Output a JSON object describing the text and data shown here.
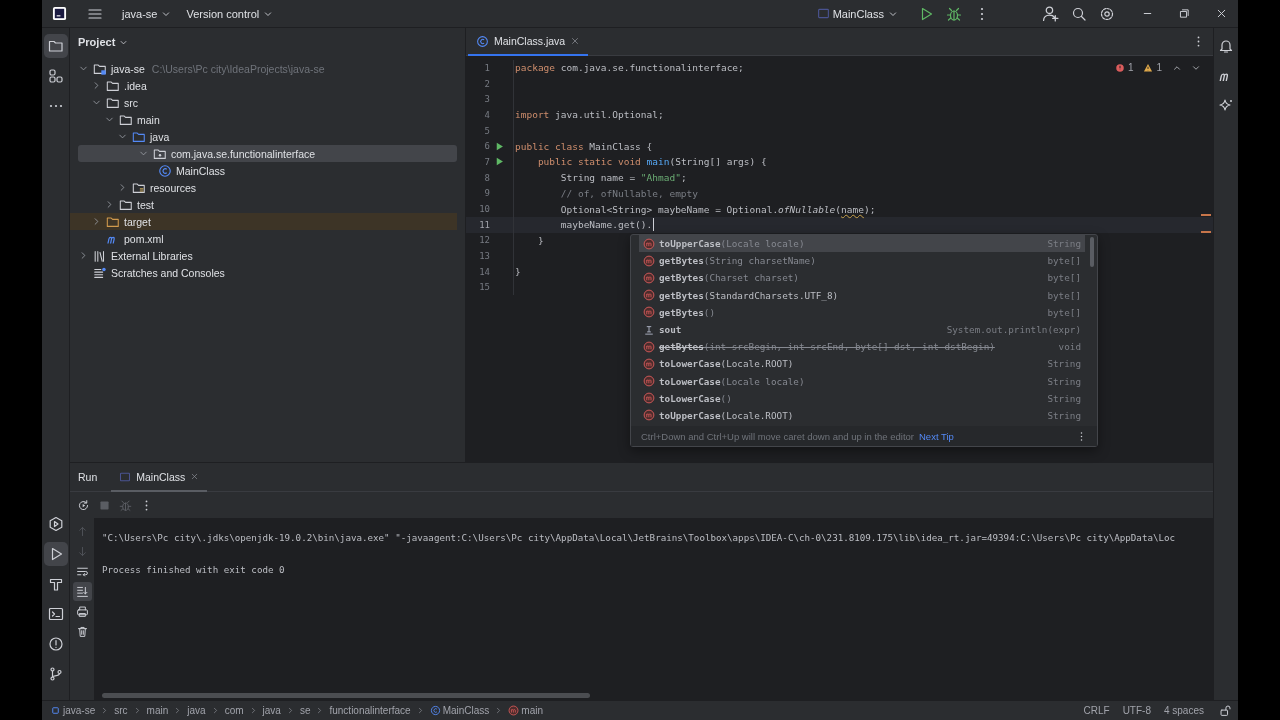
{
  "toolbar": {
    "project": "java-se",
    "vcs": "Version control",
    "run_config": "MainClass"
  },
  "project_panel": {
    "title": "Project",
    "tree": [
      {
        "label": "java-se",
        "hint": "C:\\Users\\Pc city\\IdeaProjects\\java-se",
        "kind": "module",
        "expanded": true,
        "selected": false,
        "children": [
          {
            "label": ".idea",
            "kind": "folder",
            "expanded": false,
            "selected": false
          },
          {
            "label": "src",
            "kind": "folder",
            "expanded": true,
            "selected": false,
            "children": [
              {
                "label": "main",
                "kind": "folder",
                "expanded": true,
                "selected": false,
                "children": [
                  {
                    "label": "java",
                    "kind": "source",
                    "expanded": true,
                    "selected": false,
                    "children": [
                      {
                        "label": "com.java.se.functionalinterface",
                        "kind": "package",
                        "expanded": true,
                        "selected": true,
                        "children": [
                          {
                            "label": "MainClass",
                            "kind": "class",
                            "selected": false
                          }
                        ]
                      }
                    ]
                  },
                  {
                    "label": "resources",
                    "kind": "resources",
                    "expanded": false,
                    "selected": false
                  }
                ]
              },
              {
                "label": "test",
                "kind": "folder",
                "expanded": false,
                "selected": false
              }
            ]
          },
          {
            "label": "target",
            "kind": "excluded",
            "expanded": false,
            "selected": false
          },
          {
            "label": "pom.xml",
            "kind": "maven",
            "selected": false
          }
        ]
      },
      {
        "label": "External Libraries",
        "kind": "libraries",
        "expanded": false,
        "selected": false
      },
      {
        "label": "Scratches and Consoles",
        "kind": "scratches",
        "selected": false
      }
    ]
  },
  "editor": {
    "tabs": [
      {
        "label": "MainClass.java",
        "selected": true
      }
    ],
    "errors": "1",
    "warnings": "1",
    "lines": [
      {
        "number": "1",
        "run_marker": false,
        "current": false,
        "tokens": [
          {
            "kind": "kw",
            "text": "package "
          },
          {
            "kind": "plain",
            "text": "com.java.se.functionalinterface;"
          }
        ]
      },
      {
        "number": "2",
        "run_marker": false,
        "current": false
      },
      {
        "number": "3",
        "run_marker": false,
        "current": false
      },
      {
        "number": "4",
        "run_marker": false,
        "current": false,
        "tokens": [
          {
            "kind": "kw",
            "text": "import "
          },
          {
            "kind": "plain",
            "text": "java.util.Optional;"
          }
        ]
      },
      {
        "number": "5",
        "run_marker": false,
        "current": false
      },
      {
        "number": "6",
        "run_marker": true,
        "current": false,
        "tokens": [
          {
            "kind": "kw",
            "text": "public class "
          },
          {
            "kind": "plain",
            "text": "MainClass {"
          }
        ]
      },
      {
        "number": "7",
        "run_marker": true,
        "current": false,
        "tokens": [
          {
            "kind": "kw",
            "text": "    public static void "
          },
          {
            "kind": "fn",
            "text": "main"
          },
          {
            "kind": "plain",
            "text": "(String[] args) {"
          }
        ]
      },
      {
        "number": "8",
        "run_marker": false,
        "current": false,
        "tokens": [
          {
            "kind": "plain",
            "text": "        String name = "
          },
          {
            "kind": "str",
            "text": "\"Ahmad\""
          },
          {
            "kind": "plain",
            "text": ";"
          }
        ]
      },
      {
        "number": "9",
        "run_marker": false,
        "current": false,
        "tokens": [
          {
            "kind": "cmt",
            "text": "        // of, ofNullable, empty"
          }
        ]
      },
      {
        "number": "10",
        "run_marker": false,
        "current": false,
        "tokens": [
          {
            "kind": "plain",
            "text": "        Optional<String> maybeName = Optional."
          },
          {
            "kind": "it",
            "text": "ofNullable"
          },
          {
            "kind": "plain",
            "text": "("
          },
          {
            "kind": "warn",
            "text": "name"
          },
          {
            "kind": "plain",
            "text": ");"
          }
        ]
      },
      {
        "number": "11",
        "run_marker": false,
        "current": true,
        "tokens": [
          {
            "kind": "plain",
            "text": "        maybeName.get()."
          }
        ]
      },
      {
        "number": "12",
        "run_marker": false,
        "current": false,
        "tokens": [
          {
            "kind": "plain",
            "text": "    }"
          }
        ]
      },
      {
        "number": "13",
        "run_marker": false,
        "current": false
      },
      {
        "number": "14",
        "run_marker": false,
        "current": false,
        "tokens": [
          {
            "kind": "plain",
            "text": "}"
          }
        ]
      },
      {
        "number": "15",
        "run_marker": false,
        "current": false
      }
    ]
  },
  "completion": {
    "items": [
      {
        "kind": "method",
        "name": "toUpperCase",
        "tail": "(Locale locale)",
        "tail_dim": true,
        "type": "String",
        "deprecated": false,
        "selected": true
      },
      {
        "kind": "method",
        "name": "getBytes",
        "tail": "(String charsetName)",
        "tail_dim": true,
        "type": "byte[]",
        "deprecated": false,
        "selected": false
      },
      {
        "kind": "method",
        "name": "getBytes",
        "tail": "(Charset charset)",
        "tail_dim": true,
        "type": "byte[]",
        "deprecated": false,
        "selected": false
      },
      {
        "kind": "method",
        "name": "getBytes",
        "tail": "(StandardCharsets.UTF_8)",
        "tail_dim": false,
        "type": "byte[]",
        "deprecated": false,
        "selected": false
      },
      {
        "kind": "method",
        "name": "getBytes",
        "tail": "()",
        "tail_dim": true,
        "type": "byte[]",
        "deprecated": false,
        "selected": false
      },
      {
        "kind": "template",
        "name": "sout",
        "type": "System.out.println(expr)",
        "deprecated": false,
        "selected": false
      },
      {
        "kind": "method",
        "name": "getBytes",
        "tail": "(int srcBegin, int srcEnd, byte[] dst, int dstBegin)",
        "tail_dim": true,
        "type": "void",
        "deprecated": true,
        "selected": false
      },
      {
        "kind": "method",
        "name": "toLowerCase",
        "tail": "(Locale.ROOT)",
        "tail_dim": false,
        "type": "String",
        "deprecated": false,
        "selected": false
      },
      {
        "kind": "method",
        "name": "toLowerCase",
        "tail": "(Locale locale)",
        "tail_dim": true,
        "type": "String",
        "deprecated": false,
        "selected": false
      },
      {
        "kind": "method",
        "name": "toLowerCase",
        "tail": "()",
        "tail_dim": true,
        "type": "String",
        "deprecated": false,
        "selected": false
      },
      {
        "kind": "method",
        "name": "toUpperCase",
        "tail": "(Locale.ROOT)",
        "tail_dim": false,
        "type": "String",
        "deprecated": false,
        "selected": false
      }
    ],
    "tip": "Ctrl+Down and Ctrl+Up will move caret down and up in the editor",
    "tip_link": "Next Tip"
  },
  "run_panel": {
    "title": "Run",
    "tabs": [
      {
        "label": "MainClass",
        "selected": true
      }
    ],
    "console": [
      "\"C:\\Users\\Pc city\\.jdks\\openjdk-19.0.2\\bin\\java.exe\" \"-javaagent:C:\\Users\\Pc city\\AppData\\Local\\JetBrains\\Toolbox\\apps\\IDEA-C\\ch-0\\231.8109.175\\lib\\idea_rt.jar=49394:C:\\Users\\Pc city\\AppData\\Loc",
      "Process finished with exit code 0"
    ]
  },
  "status_bar": {
    "breadcrumbs": [
      {
        "label": "java-se",
        "kind": "module"
      },
      {
        "label": "src",
        "kind": "folder"
      },
      {
        "label": "main",
        "kind": "folder"
      },
      {
        "label": "java",
        "kind": "folder"
      },
      {
        "label": "com",
        "kind": "folder"
      },
      {
        "label": "java",
        "kind": "folder"
      },
      {
        "label": "se",
        "kind": "folder"
      },
      {
        "label": "functionalinterface",
        "kind": "folder"
      },
      {
        "label": "MainClass",
        "kind": "class"
      },
      {
        "label": "main",
        "kind": "method"
      }
    ],
    "items": [
      "CRLF",
      "UTF-8",
      "4 spaces"
    ]
  }
}
